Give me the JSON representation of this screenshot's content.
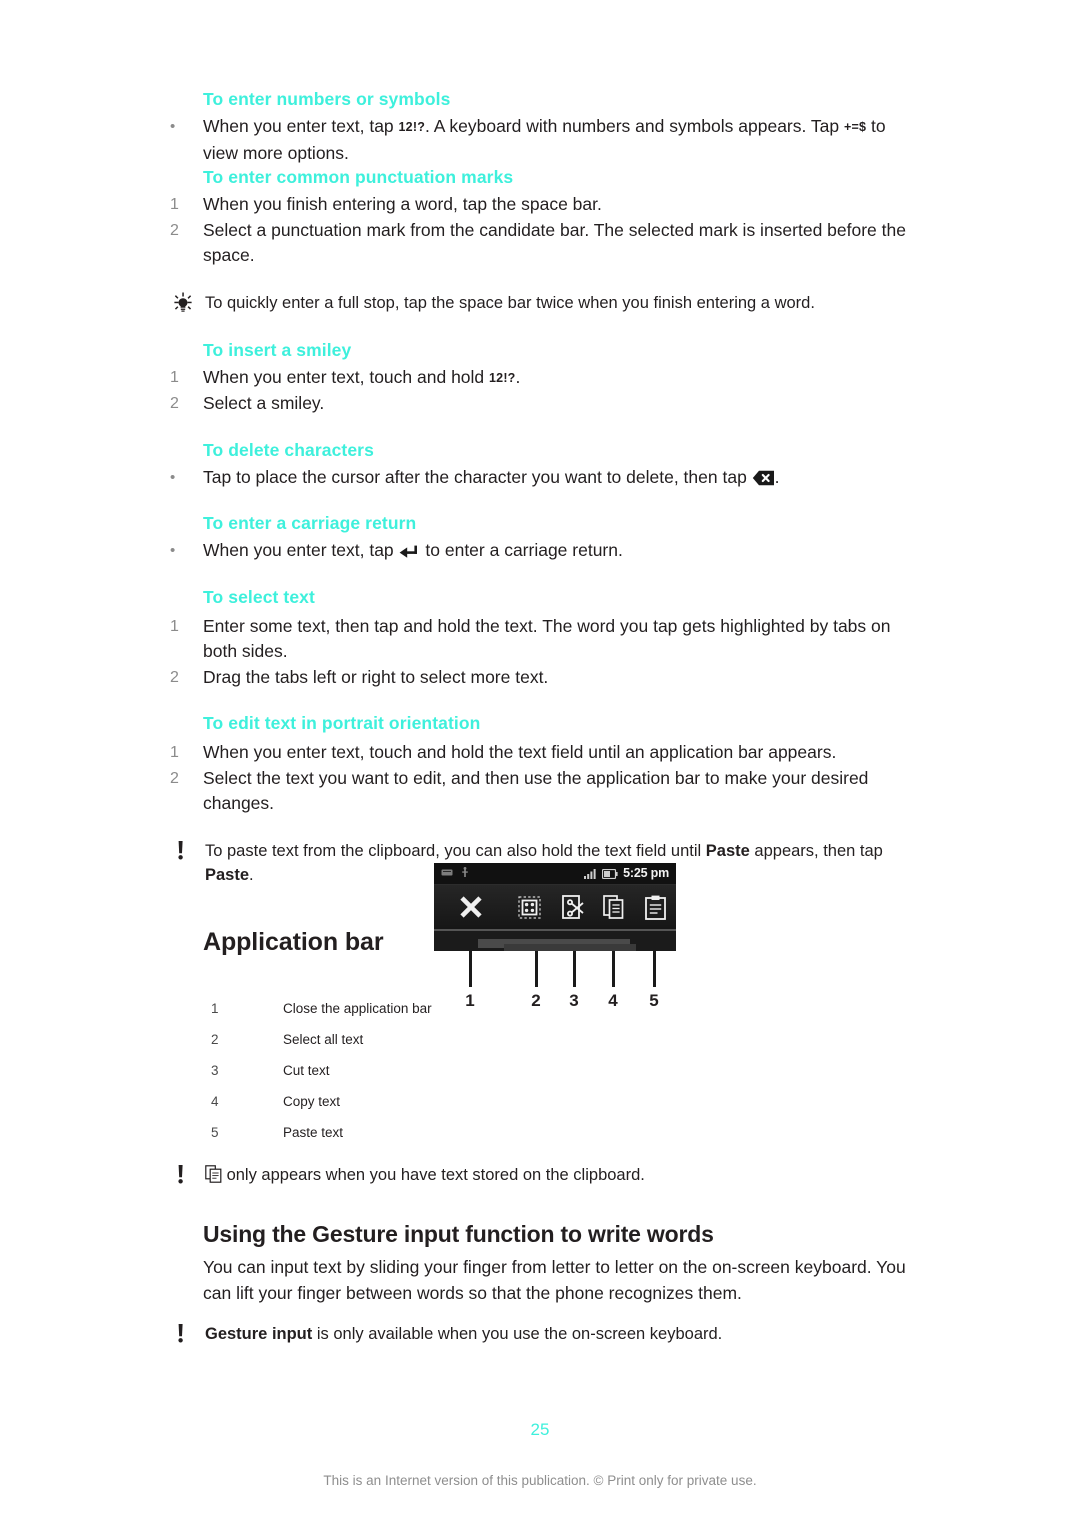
{
  "colors": {
    "heading_cyan": "#3ef0dc",
    "body_text": "#231f20",
    "marker_gray": "#8b8b8b",
    "footer_gray": "#8e8e8e"
  },
  "sections": [
    {
      "heading": "To enter numbers or symbols",
      "items": [
        {
          "marker": "•",
          "parts": [
            {
              "t": "text",
              "v": "When you enter text, tap "
            },
            {
              "t": "key",
              "v": "12!?"
            },
            {
              "t": "text",
              "v": ". A keyboard with numbers and symbols appears. Tap "
            },
            {
              "t": "key",
              "v": "+=$"
            },
            {
              "t": "text",
              "v": " to view more options."
            }
          ]
        }
      ]
    },
    {
      "heading": "To enter common punctuation marks",
      "items": [
        {
          "marker": "1",
          "parts": [
            {
              "t": "text",
              "v": "When you finish entering a word, tap the space bar."
            }
          ]
        },
        {
          "marker": "2",
          "parts": [
            {
              "t": "text",
              "v": "Select a punctuation mark from the candidate bar. The selected mark is inserted before the space."
            }
          ]
        }
      ]
    },
    {
      "heading": "To insert a smiley",
      "items": [
        {
          "marker": "1",
          "parts": [
            {
              "t": "text",
              "v": "When you enter text, touch and hold "
            },
            {
              "t": "key",
              "v": "12!?"
            },
            {
              "t": "text",
              "v": "."
            }
          ]
        },
        {
          "marker": "2",
          "parts": [
            {
              "t": "text",
              "v": "Select a smiley."
            }
          ]
        }
      ]
    },
    {
      "heading": "To delete characters",
      "items": [
        {
          "marker": "•",
          "parts": [
            {
              "t": "text",
              "v": "Tap to place the cursor after the character you want to delete, then tap "
            },
            {
              "t": "icon",
              "v": "backspace-key-icon"
            },
            {
              "t": "text",
              "v": "."
            }
          ]
        }
      ]
    },
    {
      "heading": "To enter a carriage return",
      "items": [
        {
          "marker": "•",
          "parts": [
            {
              "t": "text",
              "v": "When you enter text, tap "
            },
            {
              "t": "icon",
              "v": "return-arrow-icon"
            },
            {
              "t": "text",
              "v": " to enter a carriage return."
            }
          ]
        }
      ]
    },
    {
      "heading": "To select text",
      "items": [
        {
          "marker": "1",
          "parts": [
            {
              "t": "text",
              "v": "Enter some text, then tap and hold the text. The word you tap gets highlighted by tabs on both sides."
            }
          ]
        },
        {
          "marker": "2",
          "parts": [
            {
              "t": "text",
              "v": "Drag the tabs left or right to select more text."
            }
          ]
        }
      ]
    },
    {
      "heading": "To edit text in portrait orientation",
      "items": [
        {
          "marker": "1",
          "parts": [
            {
              "t": "text",
              "v": "When you enter text, touch and hold the text field until an application bar appears."
            }
          ]
        },
        {
          "marker": "2",
          "parts": [
            {
              "t": "text",
              "v": "Select the text you want to edit, and then use the application bar to make your desired changes."
            }
          ]
        }
      ]
    }
  ],
  "notes": {
    "tip_fullstop": {
      "icon": "lightbulb-tip-icon",
      "text": "To quickly enter a full stop, tap the space bar twice when you finish entering a word."
    },
    "note_paste": {
      "icon": "exclamation-note-icon",
      "parts": [
        {
          "t": "text",
          "v": "To paste text from the clipboard, you can also hold the text field until "
        },
        {
          "t": "bold",
          "v": "Paste"
        },
        {
          "t": "text",
          "v": " appears, then tap "
        },
        {
          "t": "bold",
          "v": "Paste"
        },
        {
          "t": "text",
          "v": "."
        }
      ]
    },
    "note_clipboard": {
      "icon": "exclamation-note-icon",
      "parts": [
        {
          "t": "icon",
          "v": "copy-paste-icon"
        },
        {
          "t": "text",
          "v": " only appears when you have text stored on the clipboard."
        }
      ]
    },
    "note_gesture": {
      "icon": "exclamation-note-icon",
      "parts": [
        {
          "t": "bold",
          "v": "Gesture input"
        },
        {
          "t": "text",
          "v": " is only available when you use the on-screen keyboard."
        }
      ]
    }
  },
  "application_bar": {
    "title": "Application bar",
    "screenshot": {
      "status_bar": {
        "time": "5:25 pm",
        "left_icons": [
          "message-icon",
          "usb-icon"
        ],
        "right_icons": [
          "signal-bars-icon",
          "battery-icon"
        ]
      },
      "toolbar_icons": [
        {
          "n": 1,
          "icon": "close-x-icon"
        },
        {
          "n": 2,
          "icon": "select-all-grid-icon"
        },
        {
          "n": 3,
          "icon": "cut-scissors-icon"
        },
        {
          "n": 4,
          "icon": "copy-documents-icon"
        },
        {
          "n": 5,
          "icon": "paste-clipboard-icon"
        }
      ],
      "callouts": [
        "1",
        "2",
        "3",
        "4",
        "5"
      ]
    },
    "legend": [
      {
        "num": "1",
        "label": "Close the application bar"
      },
      {
        "num": "2",
        "label": "Select all text"
      },
      {
        "num": "3",
        "label": "Cut text"
      },
      {
        "num": "4",
        "label": "Copy text"
      },
      {
        "num": "5",
        "label": "Paste text"
      }
    ]
  },
  "gesture_section": {
    "title": "Using the Gesture input function to write words",
    "paragraph": "You can input text by sliding your finger from letter to letter on the on-screen keyboard. You can lift your finger between words so that the phone recognizes them."
  },
  "footer": {
    "page_number": "25",
    "notice": "This is an Internet version of this publication. © Print only for private use."
  }
}
